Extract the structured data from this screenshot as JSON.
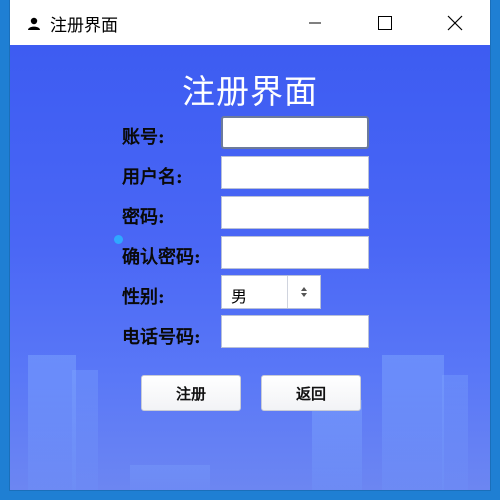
{
  "window": {
    "title": "注册界面"
  },
  "form": {
    "heading": "注册界面",
    "fields": [
      {
        "label": "账号:",
        "value": ""
      },
      {
        "label": "用户名:",
        "value": ""
      },
      {
        "label": "密码:",
        "value": ""
      },
      {
        "label": "确认密码:",
        "value": ""
      }
    ],
    "gender": {
      "label": "性别:",
      "selected": "男"
    },
    "phone": {
      "label": "电话号码:",
      "value": ""
    }
  },
  "buttons": {
    "register": "注册",
    "back": "返回"
  },
  "colors": {
    "background_top": "#3d5cf2",
    "background_bottom": "#6c86f2",
    "heading": "#ffffff"
  }
}
